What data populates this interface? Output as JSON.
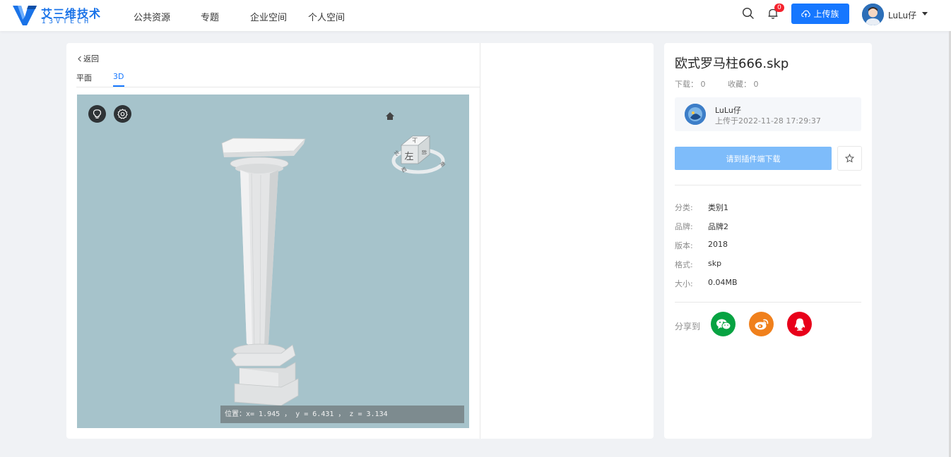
{
  "header": {
    "logo_cn": "艾三维技术",
    "logo_en": "I3VTECH",
    "nav": [
      "公共资源",
      "专题",
      "企业空间",
      "个人空间"
    ],
    "notification_count": "0",
    "upload_label": "上传族",
    "user_name": "LuLu仔"
  },
  "viewer": {
    "back_label": "返回",
    "tabs": [
      "平面",
      "3D"
    ],
    "active_tab": "3D",
    "viewcube_face": "左",
    "position_text": "位置：x= 1.945 ， y = 6.431 ， z = 3.134"
  },
  "model": {
    "title": "欧式罗马柱666.skp",
    "downloads": "下载： 0",
    "favorites": "收藏： 0",
    "author": "LuLu仔",
    "upload_time": "上传于2022-11-28 17:29:37",
    "download_button": "请到插件端下载",
    "info": [
      {
        "label": "分类:",
        "value": "类别1"
      },
      {
        "label": "品牌:",
        "value": "品牌2"
      },
      {
        "label": "版本:",
        "value": "2018"
      },
      {
        "label": "格式:",
        "value": "skp"
      },
      {
        "label": "大小:",
        "value": "0.04MB"
      }
    ],
    "share_label": "分享到"
  },
  "colors": {
    "primary": "#1677ff",
    "download_disabled": "#7ebcfa",
    "wechat": "#07a342",
    "weibo": "#f0801c",
    "qq": "#e8001a",
    "viewer_bg": "#a6c3cb"
  },
  "icons": {
    "search": "search-icon",
    "notification": "bell-icon",
    "upload": "cloud-upload-icon",
    "light": "lightbulb-icon",
    "settings": "gear-icon",
    "home": "home-icon",
    "favorite": "star-icon",
    "share": [
      "wechat-icon",
      "weibo-icon",
      "qq-icon"
    ]
  }
}
